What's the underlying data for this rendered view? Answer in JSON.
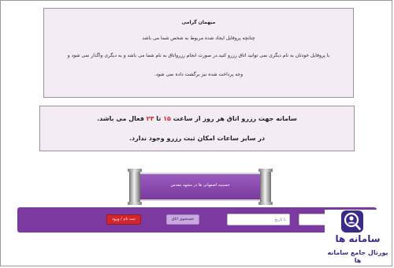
{
  "notice": {
    "greeting": "میهمان گرامی",
    "line1": "چنانچه پروفایل ایجاد شده مربوط به شخص شما می باشد",
    "line2": "با پروفایل خودتان به نام دیگری نمی توانید اتاق رزرو کنید.در صورت انجام رزرواتاق به نام شما می باشد و به دیگری واگذار نمی شود و",
    "line3": "وجه پرداخت شده نیز برگشت داده نمی شود."
  },
  "hours": {
    "line1_pre": "سامانه جهت رزرو اتاق هر روز از ساعت",
    "start_hour": "۱۵",
    "line1_mid": "تا",
    "end_hour": "۲۳",
    "line1_post": "فعال می باشد.",
    "line2": "در سایر ساعات امکان ثبت رزرو وجود ندارد.",
    "accent_color": "#d62424"
  },
  "banner": {
    "title": "حسینیه اصفهانی ها در مشهد مقدس"
  },
  "search": {
    "from_placeholder": "از تاریخ",
    "to_placeholder": "تا تاریخ",
    "search_label": "جستجوی اتاق",
    "login_label": "ثبت نام / ورود",
    "bar_color": "#7c3aa0"
  },
  "watermark": {
    "name": "سامانه ها",
    "tagline": "پورتال جامع سامانه ها",
    "icon": "person-search-icon"
  }
}
